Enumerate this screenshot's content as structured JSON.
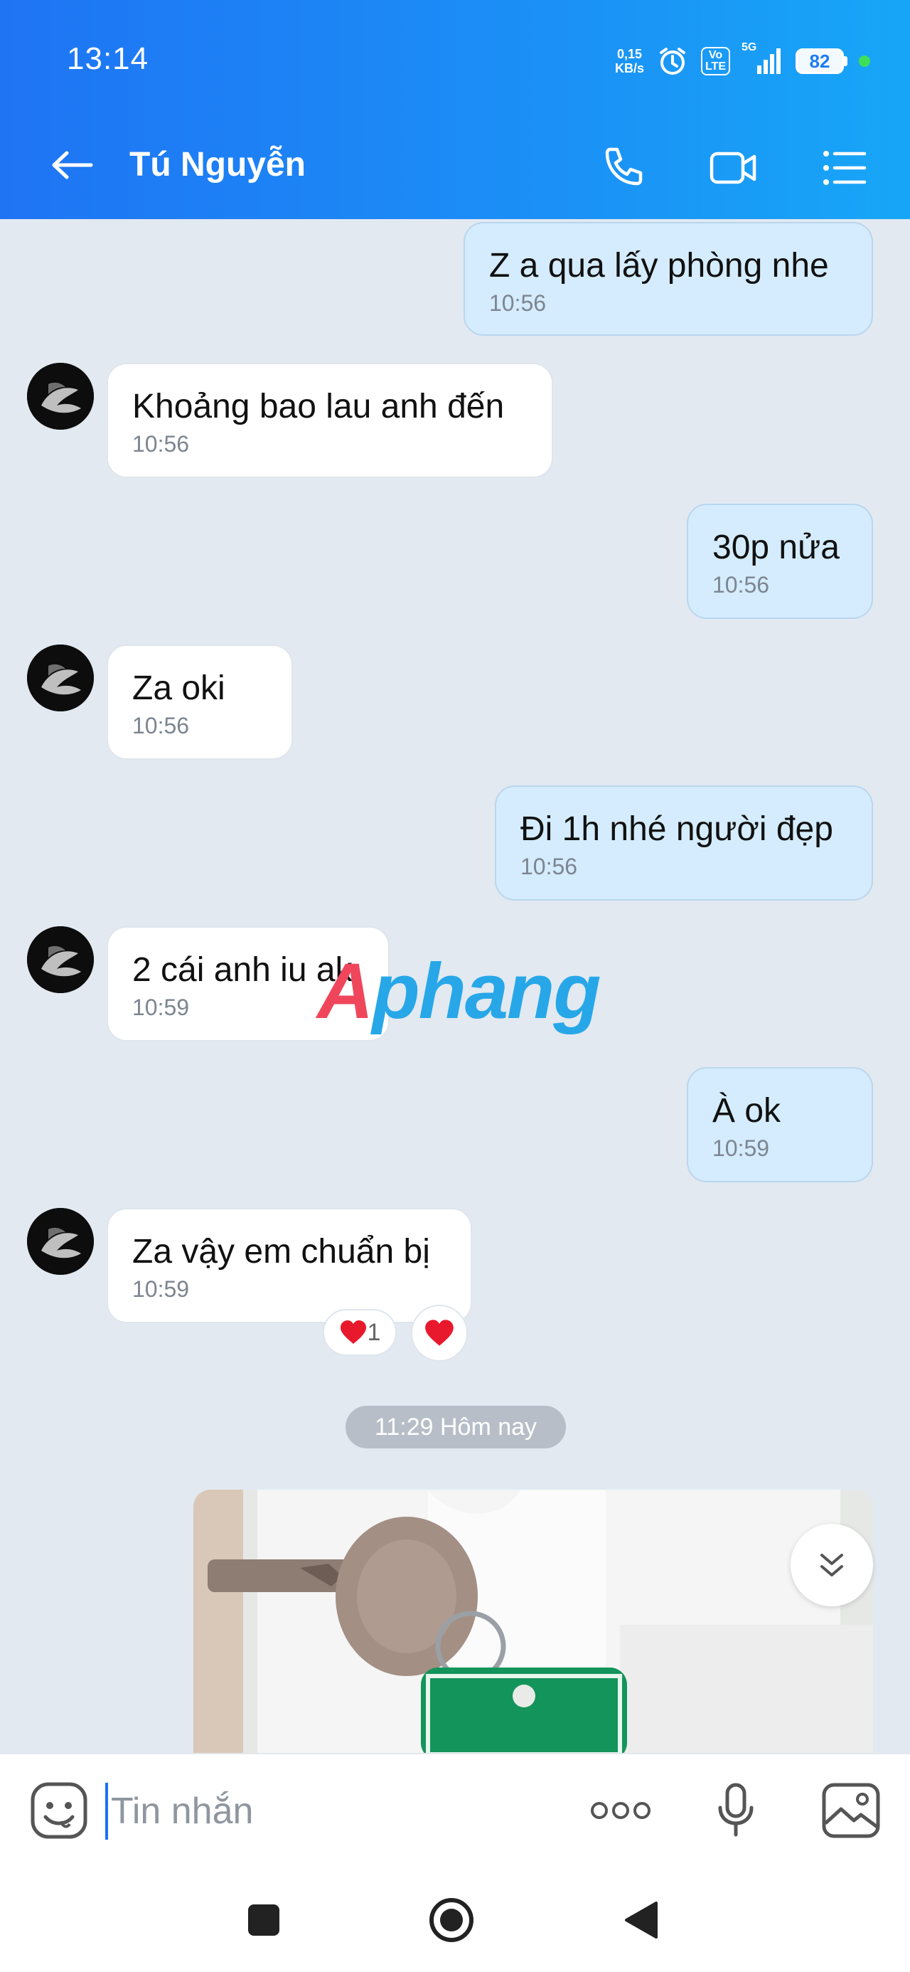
{
  "status": {
    "time": "13:14",
    "net_speed_value": "0,15",
    "net_speed_unit": "KB/s",
    "volte_top": "Vo",
    "volte_bottom": "LTE",
    "network": "5G",
    "battery": "82"
  },
  "header": {
    "contact_name": "Tú Nguyễn"
  },
  "messages": [
    {
      "dir": "out",
      "text": "Z a qua lấy phòng nhe",
      "time": "10:56"
    },
    {
      "dir": "in",
      "text": "Khoảng bao lau anh đến",
      "time": "10:56"
    },
    {
      "dir": "out",
      "text": "30p nửa",
      "time": "10:56"
    },
    {
      "dir": "in",
      "text": "Za oki",
      "time": "10:56"
    },
    {
      "dir": "out",
      "text": "Đi 1h nhé người đẹp",
      "time": "10:56"
    },
    {
      "dir": "in",
      "text": "2 cái anh iu ak",
      "time": "10:59"
    },
    {
      "dir": "out",
      "text": "À ok",
      "time": "10:59"
    },
    {
      "dir": "in",
      "text": "Za vậy em chuẩn bị",
      "time": "10:59"
    }
  ],
  "reaction": {
    "count": "1"
  },
  "date_separator": "11:29 Hôm nay",
  "watermark": {
    "first": "A",
    "rest": "phang"
  },
  "input": {
    "placeholder": "Tin nhắn"
  },
  "colors": {
    "header": "#1f74f4",
    "outgoing_bubble": "#d4ecfd",
    "incoming_bubble": "#ffffff",
    "background": "#e2e9f1"
  }
}
